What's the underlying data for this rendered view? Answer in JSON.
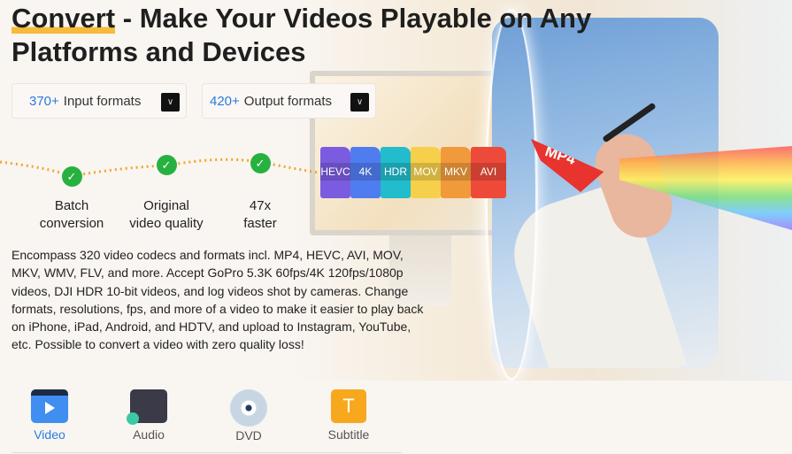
{
  "title": {
    "highlight": "Convert",
    "rest": " - Make Your Videos Playable on Any Platforms and Devices"
  },
  "formats": [
    {
      "count": "370+",
      "label": "Input formats"
    },
    {
      "count": "420+",
      "label": "Output formats"
    }
  ],
  "features": [
    {
      "line1": "Batch",
      "line2": "conversion"
    },
    {
      "line1": "Original",
      "line2": "video quality"
    },
    {
      "line1": "47x",
      "line2": "faster"
    }
  ],
  "description": "Encompass 320 video codecs and formats incl. MP4, HEVC, AVI, MOV, MKV, WMV, FLV, and more. Accept GoPro 5.3K 60fps/4K 120fps/1080p videos, DJI HDR 10-bit videos, and log videos shot by cameras. Change formats, resolutions, fps, and more of a video to make it easier to play back on iPhone, iPad, Android, and HDTV, and upload to Instagram, YouTube, etc. Possible to convert a video with zero quality loss!",
  "file_badges": [
    {
      "label": "HEVC",
      "color": "#7b5ce0"
    },
    {
      "label": "4K",
      "color": "#4f7df0"
    },
    {
      "label": "HDR",
      "color": "#22bccc"
    },
    {
      "label": "MOV",
      "color": "#f6d04a"
    },
    {
      "label": "MKV",
      "color": "#f09a3c"
    },
    {
      "label": "AVI",
      "color": "#ee4a3a"
    }
  ],
  "mp4_badge": "MP4",
  "tabs": [
    {
      "label": "Video",
      "icon": "video-icon",
      "active": true
    },
    {
      "label": "Audio",
      "icon": "audio-icon"
    },
    {
      "label": "DVD",
      "icon": "dvd-icon"
    },
    {
      "label": "Subtitle",
      "icon": "subtitle-icon"
    }
  ],
  "colors": {
    "accent": "#2b7be0",
    "check": "#27b13f",
    "highlight": "#f6bb3a"
  }
}
